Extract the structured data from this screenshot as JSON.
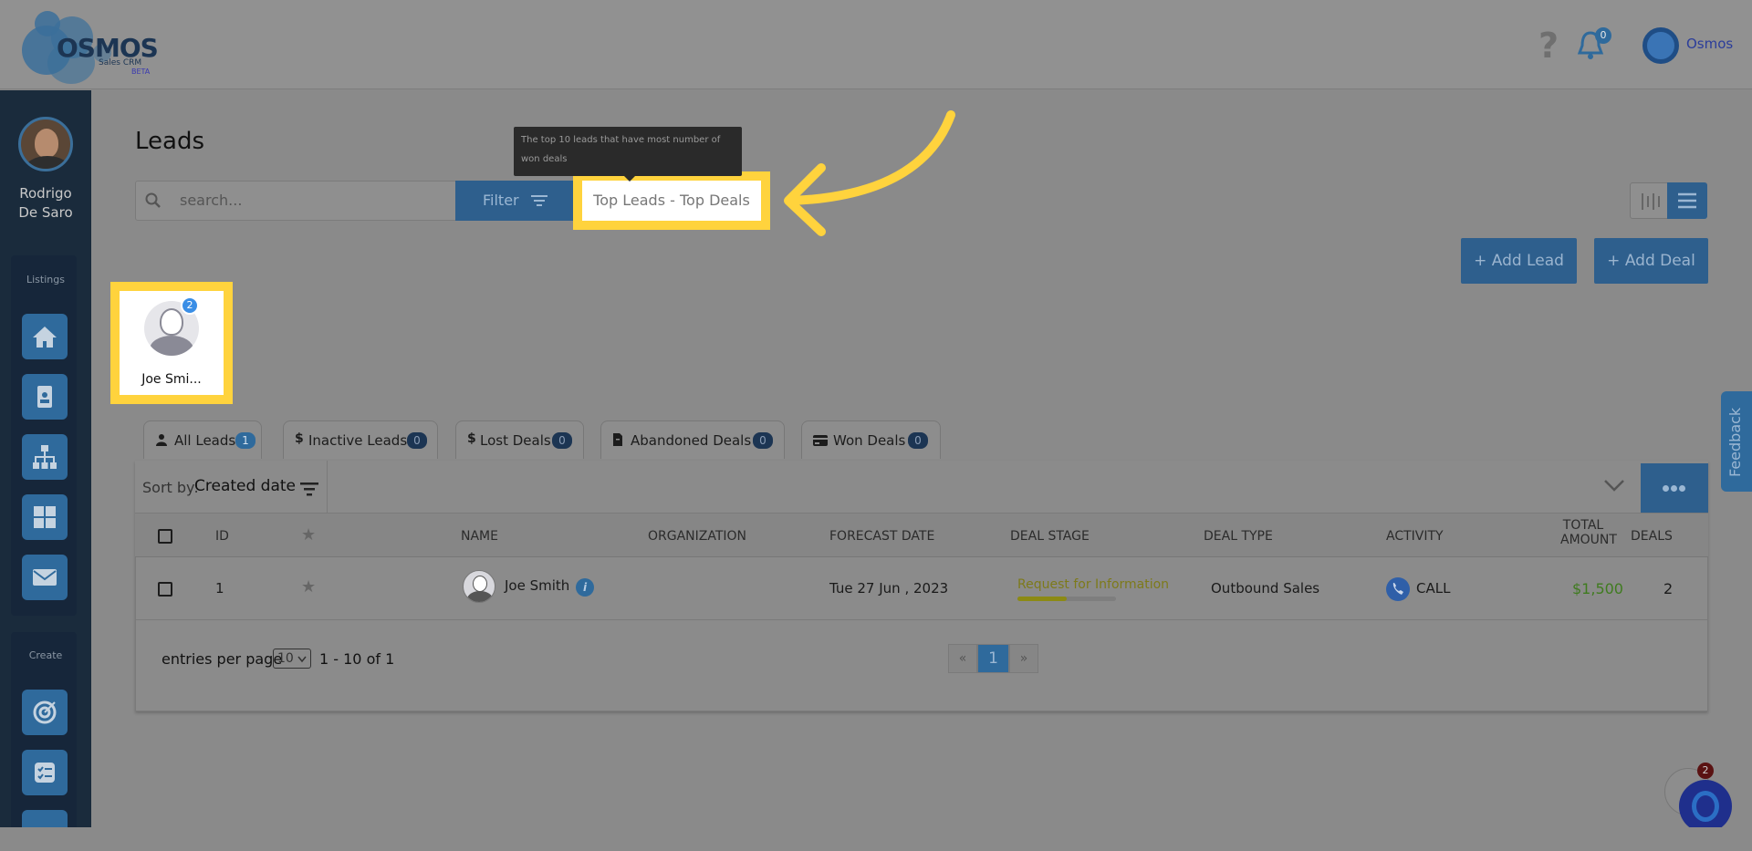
{
  "app": {
    "logo_text": "OSMOS",
    "logo_sub": "Sales CRM",
    "logo_beta": "BETA",
    "help_symbol": "?",
    "notification_count": "0",
    "user_chip_name": "Osmos"
  },
  "sidebar": {
    "user_first": "Rodrigo",
    "user_last": "De Saro",
    "listings_label": "Listings",
    "create_label": "Create",
    "listing_icons": [
      "home-icon",
      "contact-card-icon",
      "org-chart-icon",
      "dashboard-grid-icon",
      "mail-icon"
    ],
    "create_icons": [
      "target-icon",
      "checklist-icon"
    ]
  },
  "page": {
    "title": "Leads",
    "search_placeholder": "search...",
    "filter_label": "Filter",
    "top_leads_label": "Top Leads - Top Deals",
    "tooltip_text": "The top 10 leads that have most number of won deals",
    "add_lead_label": "+ Add Lead",
    "add_deal_label": "+ Add Deal"
  },
  "top_lead_card": {
    "name": "Joe Smi...",
    "badge": "2"
  },
  "tabs": [
    {
      "label": "All Leads",
      "count": "1",
      "icon": "person-icon",
      "active": true
    },
    {
      "label": "Inactive Leads",
      "count": "0",
      "icon": "dollar-icon",
      "active": false
    },
    {
      "label": "Lost Deals",
      "count": "0",
      "icon": "dollar-icon",
      "active": false
    },
    {
      "label": "Abandoned Deals",
      "count": "0",
      "icon": "file-icon",
      "active": false
    },
    {
      "label": "Won Deals",
      "count": "0",
      "icon": "card-icon",
      "active": false
    }
  ],
  "sort": {
    "label": "Sort by:",
    "value": "Created date"
  },
  "table": {
    "columns": {
      "id": "ID",
      "name": "NAME",
      "organization": "ORGANIZATION",
      "forecast_date": "FORECAST DATE",
      "deal_stage": "DEAL STAGE",
      "deal_type": "DEAL TYPE",
      "activity": "ACTIVITY",
      "total_amount_1": "TOTAL",
      "total_amount_2": "AMOUNT",
      "deals": "DEALS"
    },
    "rows": [
      {
        "id": "1",
        "name": "Joe Smith",
        "organization": "",
        "forecast_date": "Tue 27 Jun , 2023",
        "deal_stage": "Request for Information",
        "deal_stage_progress": 0.5,
        "deal_type": "Outbound Sales",
        "activity": "CALL",
        "total_amount": "$1,500",
        "deals": "2"
      }
    ]
  },
  "pagination": {
    "entries_label": "entries per page",
    "per_page": "10",
    "range": "1 - 10 of 1",
    "prev": "«",
    "current": "1",
    "next": "»"
  },
  "feedback_label": "Feedback",
  "chat_badge": "2",
  "colors": {
    "primary": "#2f6a9c",
    "highlight": "#ffd33d",
    "sidebar": "#1a2b3c",
    "amount_green": "#3f7b1f"
  }
}
